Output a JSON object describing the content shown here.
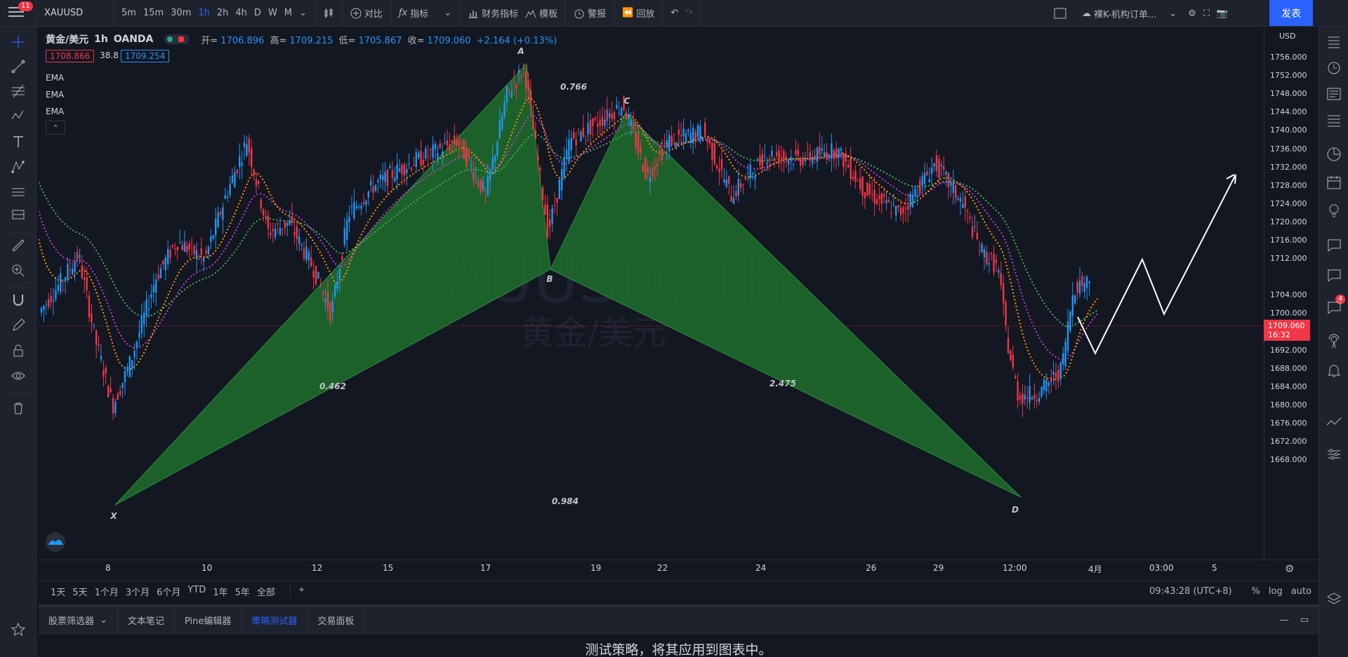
{
  "topbar": {
    "notif_count": "11",
    "symbol": "XAUUSD",
    "intervals": [
      "5m",
      "15m",
      "30m",
      "1h",
      "2h",
      "4h",
      "D",
      "W",
      "M"
    ],
    "active_interval": "1h",
    "compare": "对比",
    "indicators": "指标",
    "financials": "财务指标",
    "templates": "模板",
    "alert": "警报",
    "replay": "回放",
    "layout_name": "裸K-机构订单...",
    "publish": "发表"
  },
  "legend": {
    "symbol": "黄金/美元",
    "interval": "1h",
    "exchange": "OANDA",
    "open_label": "开=",
    "open": "1706.896",
    "high_label": "高=",
    "high": "1709.215",
    "low_label": "低=",
    "low": "1705.867",
    "close_label": "收=",
    "close": "1709.060",
    "change": "+2.164 (+0.13%)",
    "bid": "1708.866",
    "spread": "38.8",
    "ask": "1709.254",
    "indicators": [
      "EMA",
      "EMA",
      "EMA"
    ]
  },
  "watermark": {
    "main": "XAUUSD, 1h",
    "sub": "黄金/美元"
  },
  "pattern": {
    "points": [
      "X",
      "A",
      "B",
      "C",
      "D"
    ],
    "ratios": [
      "0.766",
      "0.462",
      "2.475",
      "0.984"
    ]
  },
  "price_axis": {
    "currency": "USD",
    "labels": [
      "1756.000",
      "1752.000",
      "1748.000",
      "1744.000",
      "1740.000",
      "1736.000",
      "1732.000",
      "1728.000",
      "1724.000",
      "1720.000",
      "1716.000",
      "1712.000",
      "1704.000",
      "1700.000",
      "1696.000",
      "1692.000",
      "1688.000",
      "1684.000",
      "1680.000",
      "1676.000",
      "1672.000",
      "1668.000"
    ],
    "current_price": "1709.060",
    "countdown": "16:32"
  },
  "time_axis": {
    "labels": [
      "8",
      "10",
      "12",
      "15",
      "17",
      "19",
      "22",
      "24",
      "26",
      "29",
      "12:00",
      "4月",
      "03:00",
      "5"
    ]
  },
  "range_bar": {
    "ranges": [
      "1天",
      "5天",
      "1个月",
      "3个月",
      "6个月",
      "YTD",
      "1年",
      "5年",
      "全部"
    ],
    "clock": "09:43:28 (UTC+8)",
    "percent": "%",
    "log": "log",
    "auto": "auto"
  },
  "bottom_panel": {
    "tabs": [
      "股票筛选器",
      "文本笔记",
      "Pine编辑器",
      "策略测试器",
      "交易面板"
    ],
    "active_tab": "策略测试器",
    "message": "测试策略，将其应用到图表中。"
  },
  "right_badge": "4",
  "colors": {
    "up": "#2196f3",
    "down": "#f23645",
    "pattern_fill": "#1e6e2c",
    "ema1": "#4caf50",
    "ema2": "#c040d0",
    "ema3": "#ff9800"
  }
}
